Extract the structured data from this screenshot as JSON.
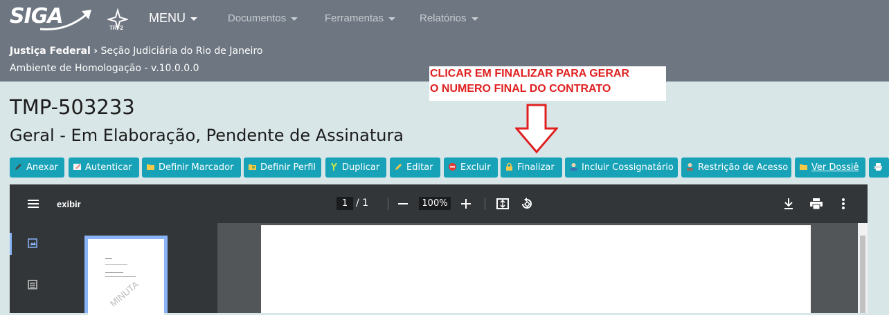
{
  "nav": {
    "logo": "SIGA",
    "trf_label": "TRF2",
    "menu_label": "MENU",
    "items": [
      "Documentos",
      "Ferramentas",
      "Relatórios"
    ]
  },
  "breadcrumb": {
    "root": "Justiça Federal",
    "current": "Seção Judiciária do Rio de Janeiro"
  },
  "environment": "Ambiente de Homologação - v.10.0.0.0",
  "annotation": {
    "line1": "CLICAR EM FINALIZAR PARA GERAR",
    "line2": "O NUMERO FINAL DO CONTRATO"
  },
  "document": {
    "id": "TMP-503233",
    "status": "Geral - Em Elaboração, Pendente de Assinatura"
  },
  "toolbar": {
    "buttons": [
      {
        "label": "Anexar",
        "icon": "pencil-icon"
      },
      {
        "label": "Autenticar",
        "icon": "stamp-icon"
      },
      {
        "label": "Definir Marcador",
        "icon": "folder-icon"
      },
      {
        "label": "Definir Perfil",
        "icon": "folder-user-icon"
      },
      {
        "label": "Duplicar",
        "icon": "duplicate-icon"
      },
      {
        "label": "Editar",
        "icon": "pencil-icon"
      },
      {
        "label": "Excluir",
        "icon": "delete-icon"
      },
      {
        "label": "Finalizar",
        "icon": "lock-icon"
      },
      {
        "label": "Incluir Cossignatário",
        "icon": "user-add-icon"
      },
      {
        "label": "Restrição de Acesso",
        "icon": "user-lock-icon"
      },
      {
        "label": "Ver Dossiê",
        "icon": "folder-open-icon"
      }
    ]
  },
  "viewer": {
    "file_name": "exibir",
    "current_page": "1",
    "total_pages": "1",
    "zoom": "100%",
    "thumbnail_watermark": "MINUTA"
  },
  "colors": {
    "nav_bg": "#6e7681",
    "button_bg": "#17a2b8",
    "annotation_red": "#e02020",
    "viewer_bar": "#323639"
  }
}
